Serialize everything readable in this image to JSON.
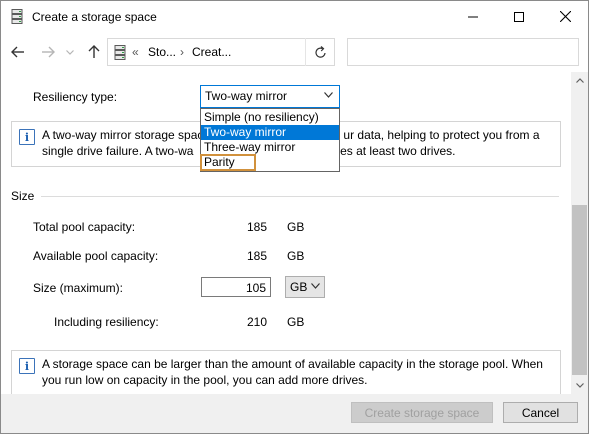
{
  "window": {
    "title": "Create a storage space",
    "icon": "storage-spaces-icon"
  },
  "nav": {
    "back_icon": "arrow-left-icon",
    "forward_icon": "arrow-right-icon",
    "recent_icon": "chevron-down-icon",
    "up_icon": "arrow-up-icon",
    "address": {
      "separator": "«",
      "crumbs": [
        "Sto...",
        "Creat..."
      ],
      "arrow": "›"
    },
    "refresh_icon": "refresh-icon",
    "search_placeholder": ""
  },
  "resiliency": {
    "label": "Resiliency type:",
    "selected": "Two-way mirror",
    "options": [
      "Simple (no resiliency)",
      "Two-way mirror",
      "Three-way mirror",
      "Parity"
    ],
    "hovered": "Parity"
  },
  "resiliency_info": {
    "line1_start": "A two-way mirror storage spac",
    "line1_end": "ur data, helping to protect you from a",
    "line2_start": "single drive failure. A two-wa",
    "line2_end": "ires at least two drives."
  },
  "size_section": {
    "title": "Size",
    "total_label": "Total pool capacity:",
    "total_value": "185",
    "total_unit": "GB",
    "available_label": "Available pool capacity:",
    "available_value": "185",
    "available_unit": "GB",
    "size_label": "Size (maximum):",
    "size_value": "105",
    "size_unit": "GB",
    "resiliency_label": "Including resiliency:",
    "resiliency_value": "210",
    "resiliency_unit": "GB"
  },
  "capacity_info": {
    "line1": "A storage space can be larger than the amount of available capacity in the storage pool. When",
    "line2": "you run low on capacity in the pool, you can add more drives."
  },
  "buttons": {
    "create": "Create storage space",
    "cancel": "Cancel"
  },
  "colors": {
    "accent": "#0078d7",
    "hover_outline": "#d1913c",
    "info_icon": "#1b5fb0"
  }
}
